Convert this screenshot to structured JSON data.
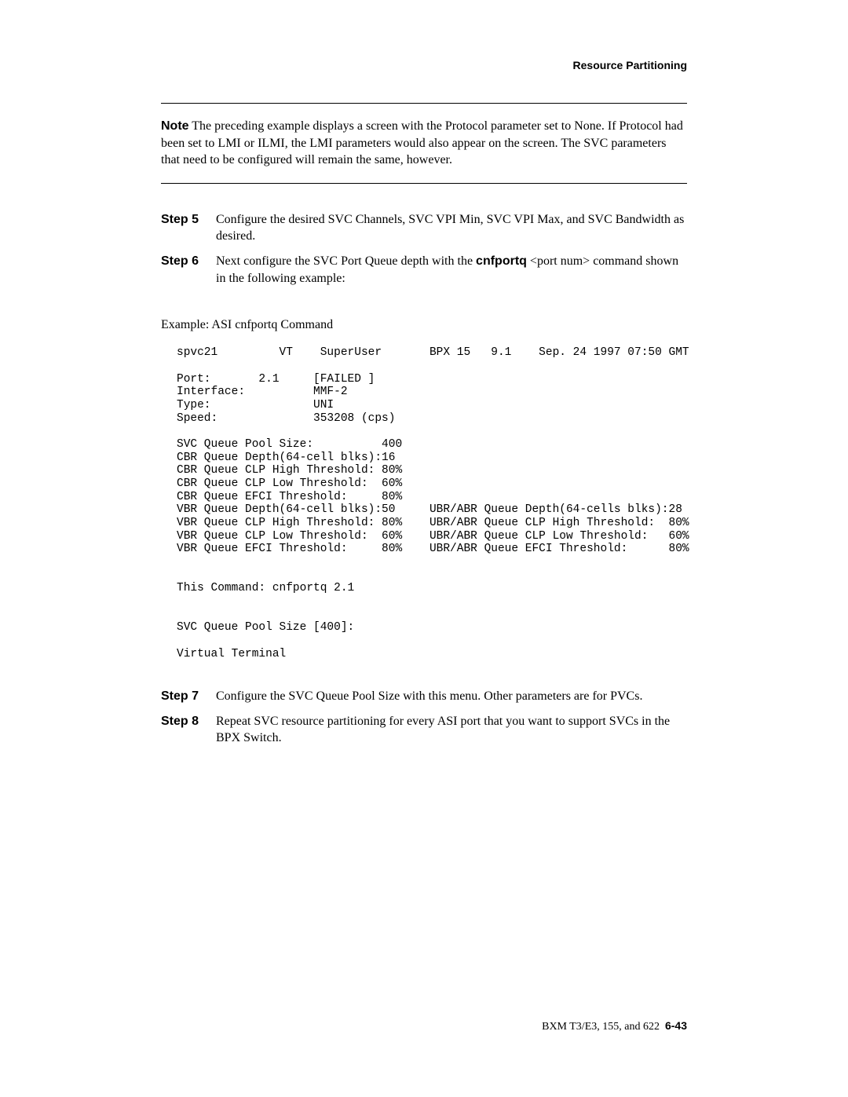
{
  "header": {
    "section_title": "Resource Partitioning"
  },
  "note": {
    "label": "Note",
    "text": "The preceding example displays a screen with the Protocol parameter set to None. If Protocol had been set to LMI or ILMI, the LMI parameters would also appear on the screen. The SVC parameters that need to be configured will remain the same, however."
  },
  "steps_a": [
    {
      "label": "Step 5",
      "text": "Configure the desired SVC Channels, SVC VPI Min, SVC VPI Max, and SVC Bandwidth as desired."
    },
    {
      "label": "Step 6",
      "text_before": "Next configure the SVC Port Queue depth with the ",
      "cmd": "cnfportq",
      "text_after": " <port num> command shown in the following example:"
    }
  ],
  "example": {
    "title": "Example: ASI cnfportq Command",
    "terminal": "spvc21         VT    SuperUser       BPX 15   9.1    Sep. 24 1997 07:50 GMT\n\nPort:       2.1     [FAILED ]\nInterface:          MMF-2\nType:               UNI\nSpeed:              353208 (cps)\n\nSVC Queue Pool Size:          400\nCBR Queue Depth(64-cell blks):16\nCBR Queue CLP High Threshold: 80%\nCBR Queue CLP Low Threshold:  60%\nCBR Queue EFCI Threshold:     80%\nVBR Queue Depth(64-cell blks):50     UBR/ABR Queue Depth(64-cells blks):28\nVBR Queue CLP High Threshold: 80%    UBR/ABR Queue CLP High Threshold:  80%\nVBR Queue CLP Low Threshold:  60%    UBR/ABR Queue CLP Low Threshold:   60%\nVBR Queue EFCI Threshold:     80%    UBR/ABR Queue EFCI Threshold:      80%\n\n\nThis Command: cnfportq 2.1\n\n\nSVC Queue Pool Size [400]:\n\nVirtual Terminal"
  },
  "steps_b": [
    {
      "label": "Step 7",
      "text": "Configure the SVC Queue Pool Size with this menu. Other parameters are for PVCs."
    },
    {
      "label": "Step 8",
      "text": "Repeat SVC resource partitioning for every ASI port that you want to support SVCs in the BPX Switch."
    }
  ],
  "footer": {
    "book": "BXM T3/E3, 155, and 622",
    "page": "6-43"
  }
}
